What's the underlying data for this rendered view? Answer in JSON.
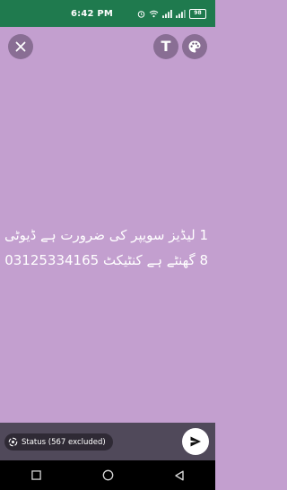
{
  "status_bar": {
    "time": "6:42 PM",
    "battery": "98"
  },
  "toolbar": {
    "close_icon": "close-icon",
    "text_label": "T",
    "palette_icon": "palette-icon"
  },
  "composer": {
    "background_color": "#c39fcf",
    "lines": [
      "1 لیڈیز سویپر کی ضرورت ہے ڈیوٹی",
      "8 گھنٹے ہے کنٹیکٹ 03125334165"
    ]
  },
  "footer": {
    "audience_label": "Status (567 excluded)",
    "send_icon": "send-icon"
  },
  "nav": {
    "icons": [
      "recents-icon",
      "home-icon",
      "back-icon"
    ]
  }
}
